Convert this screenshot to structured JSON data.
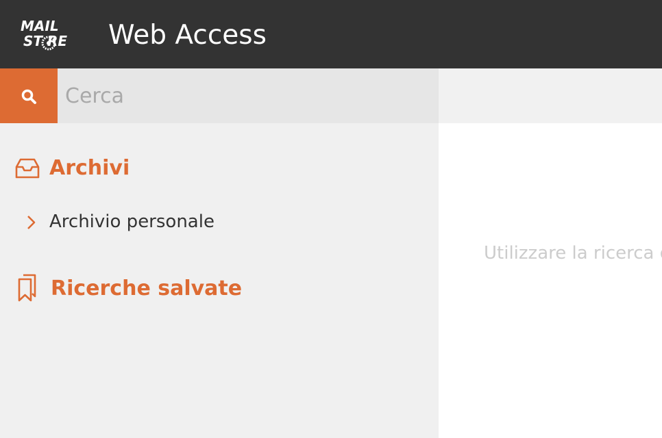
{
  "header": {
    "logo_line1": "MAIL",
    "logo_line2": "ST RE",
    "app_title": "Web Access",
    "background": "#333333"
  },
  "search": {
    "placeholder": "Cerca",
    "value": "",
    "button_icon": "search-icon"
  },
  "sidebar": {
    "archives_heading": "Archivi",
    "archives_icon": "inbox-icon",
    "items": [
      {
        "label": "Archivio personale",
        "icon": "chevron-right-icon"
      }
    ],
    "saved_searches_heading": "Ricerche salvate",
    "saved_searches_icon": "bookmarks-icon"
  },
  "main": {
    "hint_text": "Utilizzare la ricerca o"
  },
  "colors": {
    "accent": "#dd6b33",
    "sidebar_bg": "#f0f0f0",
    "search_field_bg": "#e6e6e6",
    "text": "#333333",
    "placeholder": "#a9a9a9",
    "hint": "#cccccc"
  }
}
